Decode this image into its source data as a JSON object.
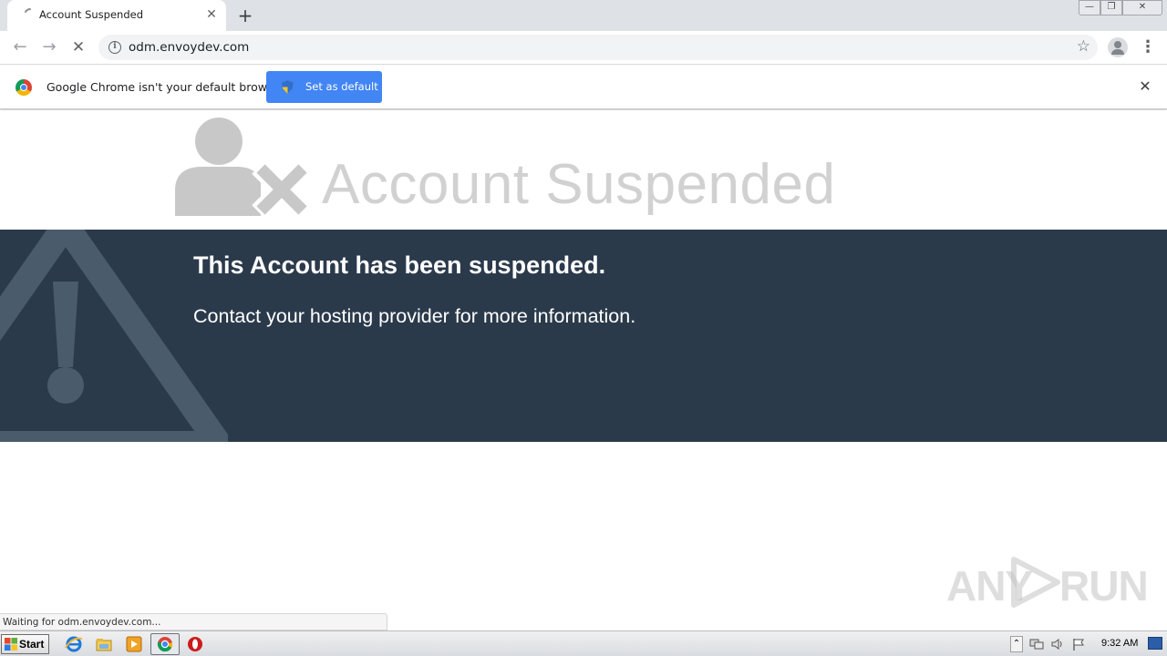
{
  "browser": {
    "tab": {
      "title": "Account Suspended",
      "close_glyph": "✕"
    },
    "new_tab_glyph": "+",
    "window_controls": {
      "minimize": "—",
      "maximize": "❐",
      "close": "✕"
    },
    "toolbar": {
      "back_glyph": "←",
      "forward_glyph": "→",
      "stop_glyph": "✕",
      "url": "odm.envoydev.com",
      "info_glyph": "i",
      "bookmark_glyph": "☆",
      "menu_glyph": "⋮"
    },
    "infobar": {
      "message": "Google Chrome isn't your default browser",
      "button_label": "Set as default",
      "close_glyph": "✕"
    },
    "status_text": "Waiting for odm.envoydev.com..."
  },
  "page": {
    "header_title": "Account Suspended",
    "banner_heading": "This Account has been suspended.",
    "banner_text": "Contact your hosting provider for more information.",
    "colors": {
      "banner_bg": "#2b3a4b",
      "header_text": "#d1d1d1",
      "icon_gray": "#c8c8c8",
      "warning_icon": "#4a5b6c"
    }
  },
  "watermark": {
    "left": "ANY",
    "right": "RUN"
  },
  "taskbar": {
    "start_label": "Start",
    "pinned": [
      "ie-icon",
      "explorer-icon",
      "media-player-icon",
      "chrome-icon",
      "opera-icon"
    ],
    "clock": "9:32 AM",
    "tray_arrow": "⌃"
  }
}
